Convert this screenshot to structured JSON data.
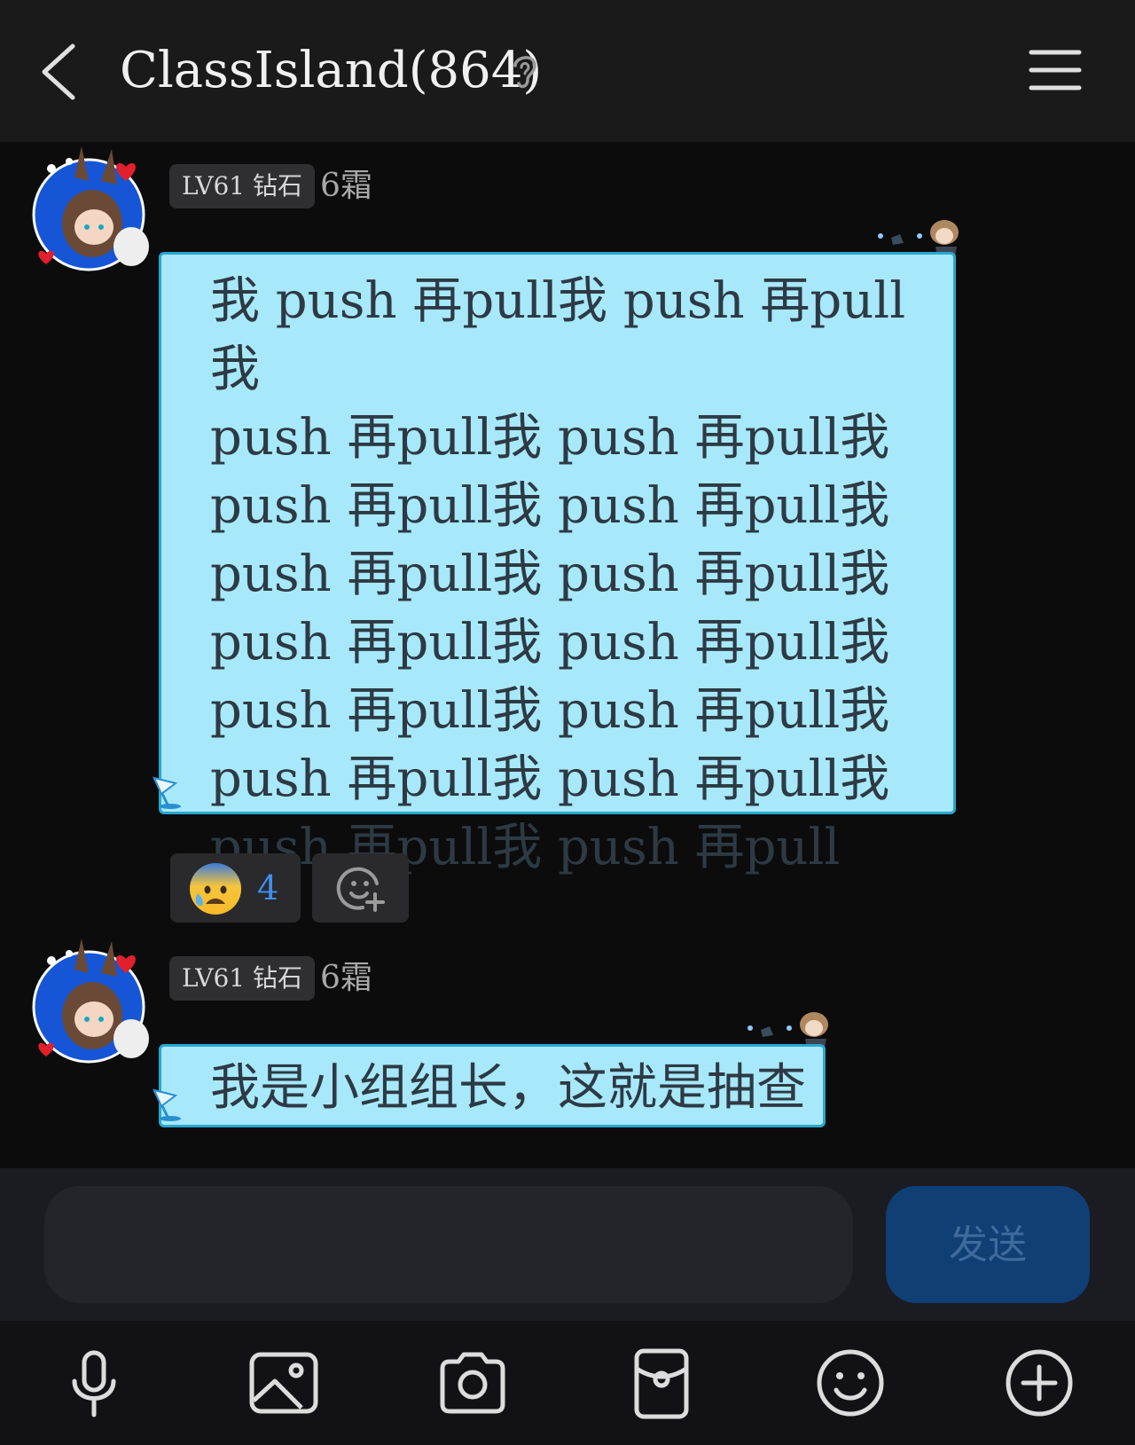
{
  "header": {
    "title": "ClassIsland(864)",
    "icons": [
      "back-icon",
      "ear-icon",
      "menu-icon"
    ]
  },
  "messages": [
    {
      "badge": "LV61 钻石",
      "nickname": "6霜",
      "text": "我 push 再pull我 push 再pull我 push 再pull我 push 再pull我 push 再pull我 push 再pull我 push 再pull我 push 再pull我 push 再pull我 push 再pull我 push 再pull我 push 再pull我 push 再pull我 push 再pull我 push 再pull我 push 再pull",
      "lines": [
        "我 push 再pull我 push 再pull我",
        "push 再pull我 push 再pull我",
        "push 再pull我 push 再pull我",
        "push 再pull我 push 再pull我",
        "push 再pull我 push 再pull我",
        "push 再pull我 push 再pull我",
        "push 再pull我 push 再pull我",
        "push 再pull我 push 再pull"
      ],
      "reactions": [
        {
          "emoji": "😰",
          "count": "4"
        }
      ]
    },
    {
      "badge": "LV61 钻石",
      "nickname": "6霜",
      "text": "我是小组组长，这就是抽查"
    }
  ],
  "input": {
    "placeholder": "",
    "value": "",
    "send_label": "发送"
  },
  "toolbar": {
    "icons": [
      "microphone-icon",
      "image-icon",
      "camera-icon",
      "red-packet-icon",
      "emoji-icon",
      "plus-icon"
    ]
  },
  "colors": {
    "bubble_bg": "#a8e8fb",
    "bubble_border": "#2aa7cf",
    "send_bg": "#0f3f75",
    "reaction_count": "#3f8ff0"
  }
}
